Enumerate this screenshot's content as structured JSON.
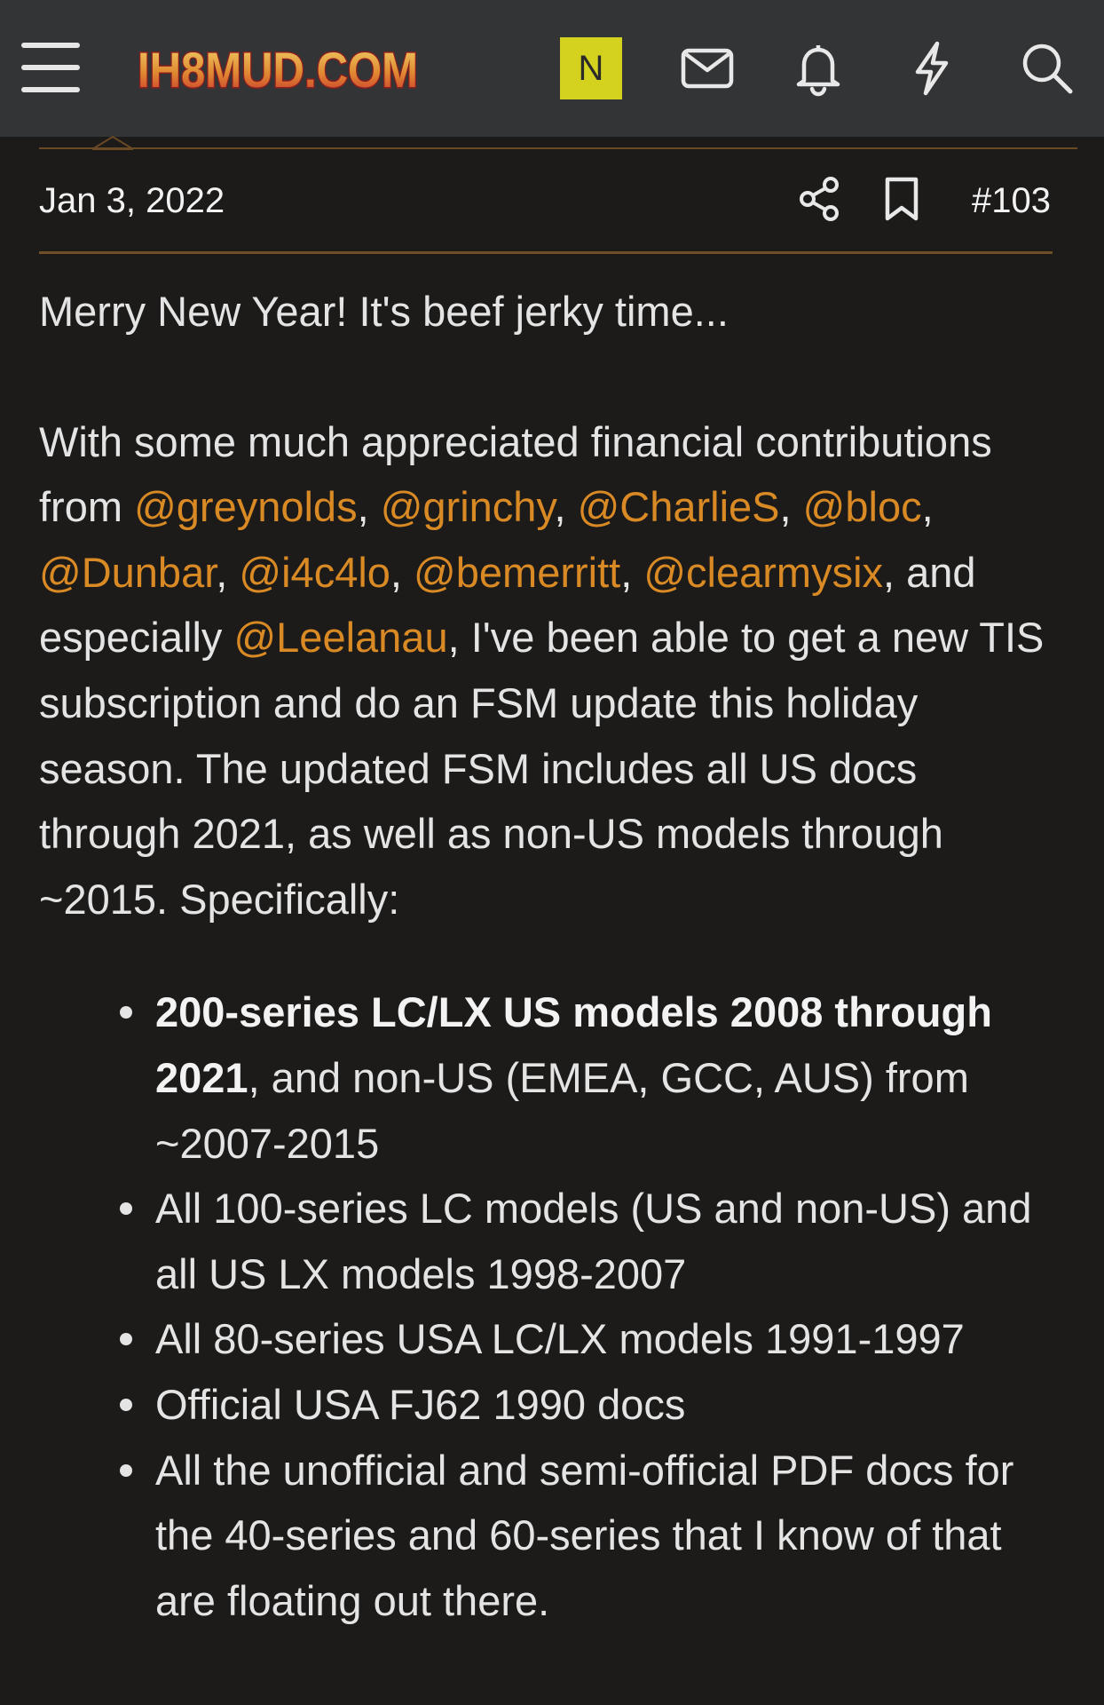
{
  "header": {
    "logo_text": "IH8MUD.COM",
    "avatar_letter": "N",
    "icons": [
      "menu-icon",
      "envelope-icon",
      "bell-icon",
      "lightning-icon",
      "search-icon"
    ]
  },
  "post": {
    "date": "Jan 3, 2022",
    "number": "#103",
    "action_icons": [
      "share-icon",
      "bookmark-icon"
    ],
    "greeting": "Merry New Year! It's beef jerky time...",
    "intro": {
      "prefix": "With some much appreciated financial contributions from ",
      "mentions": [
        "@greynolds",
        "@grinchy",
        "@CharlieS",
        "@bloc",
        "@Dunbar",
        "@i4c4lo",
        "@bemerritt",
        "@clearmysix",
        "@Leelanau"
      ],
      "sep": ", ",
      "and_especially": ", and especially ",
      "suffix": ", I've been able to get a new TIS subscription and do an FSM update this holiday season. The updated FSM includes all US docs through 2021, as well as non-US models through ~2015. Specifically:"
    },
    "list": [
      {
        "bold": "200-series LC/LX US models 2008 through 2021",
        "rest": ", and non-US (EMEA, GCC, AUS) from ~2007-2015"
      },
      {
        "bold": "",
        "rest": "All 100-series LC models (US and non-US) and all US LX models 1998-2007"
      },
      {
        "bold": "",
        "rest": "All 80-series USA LC/LX models 1991-1997"
      },
      {
        "bold": "",
        "rest": "Official USA FJ62 1990 docs"
      },
      {
        "bold": "",
        "rest": "All the unofficial and semi-official PDF docs for the 40-series and 60-series that I know of that are floating out there."
      }
    ]
  },
  "colors": {
    "background": "#1c1b1a",
    "topbar": "#333436",
    "mention": "#d98a24",
    "rule": "#6e4f27",
    "avatar": "#d4d21f"
  }
}
